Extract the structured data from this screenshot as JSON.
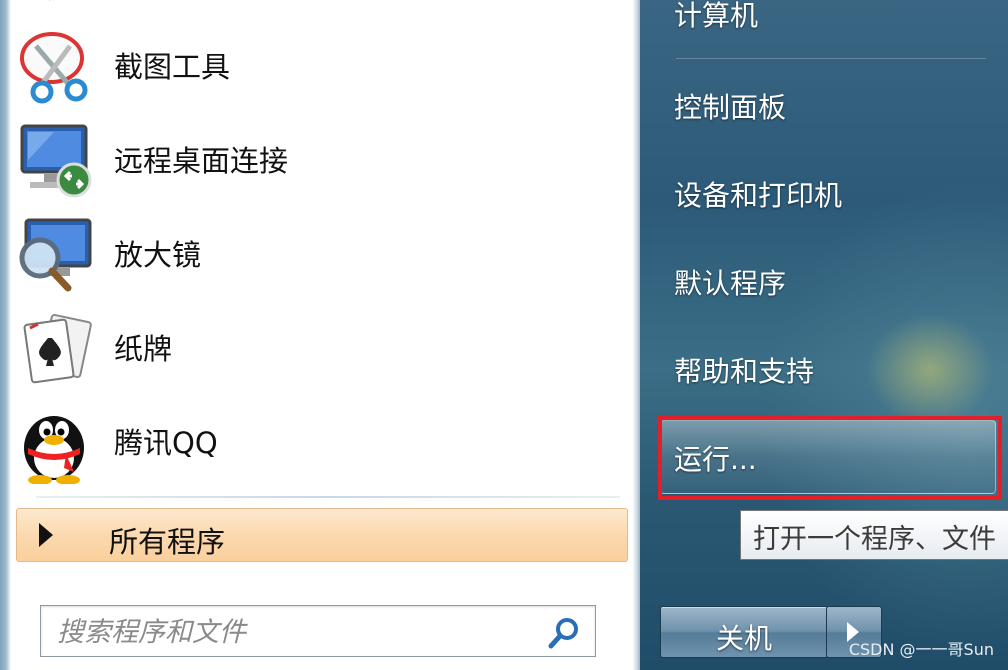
{
  "left": {
    "programs": [
      {
        "label": "截图工具",
        "icon": "snipping-tool-icon"
      },
      {
        "label": "远程桌面连接",
        "icon": "remote-desktop-icon"
      },
      {
        "label": "放大镜",
        "icon": "magnifier-icon"
      },
      {
        "label": "纸牌",
        "icon": "solitaire-icon"
      },
      {
        "label": "腾讯QQ",
        "icon": "qq-penguin-icon"
      }
    ],
    "all_programs_label": "所有程序",
    "search": {
      "placeholder": "搜索程序和文件",
      "value": ""
    }
  },
  "right": {
    "items": [
      {
        "label": "计算机"
      },
      {
        "label": "控制面板"
      },
      {
        "label": "设备和打印机"
      },
      {
        "label": "默认程序"
      },
      {
        "label": "帮助和支持"
      },
      {
        "label": "运行..."
      }
    ],
    "tooltip": "打开一个程序、文件",
    "shutdown_label": "关机"
  },
  "watermark": "CSDN @一一哥Sun",
  "colors": {
    "highlight_frame": "#e3202a",
    "all_programs_bg": "#fbd8ac",
    "right_panel": "#2c5a78"
  }
}
